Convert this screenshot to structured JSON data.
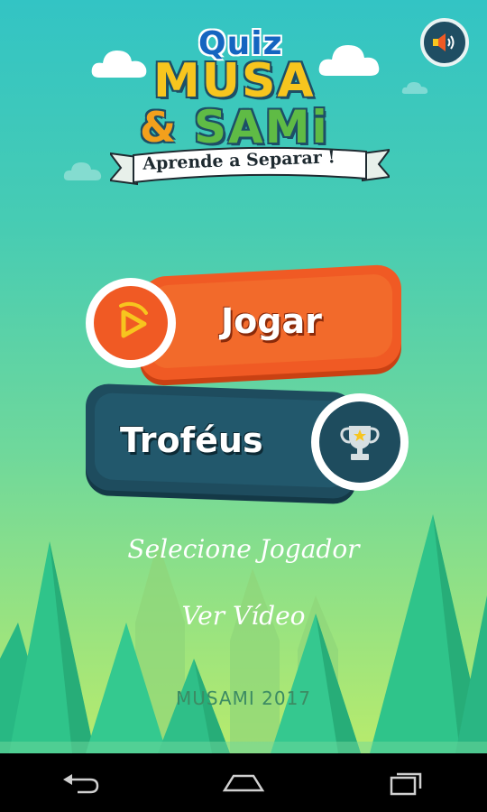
{
  "logo": {
    "quiz": "Quiz",
    "musa": "MUSA",
    "and": "&",
    "sami": "SAMi",
    "tagline": "Aprende a Separar !"
  },
  "sound": {
    "icon": "speaker-volume-icon"
  },
  "menu": {
    "play_label": "Jogar",
    "play_icon": "play-icon",
    "trophies_label": "Troféus",
    "trophies_icon": "trophy-icon",
    "select_player_label": "Selecione Jogador",
    "watch_video_label": "Ver Vídeo"
  },
  "footer": {
    "credit": "MUSAMI 2017"
  },
  "navbar": {
    "back_icon": "back-arrow-icon",
    "home_icon": "home-icon",
    "recents_icon": "recent-apps-icon"
  },
  "colors": {
    "sky_top": "#33c4c4",
    "sky_bottom": "#b8eb6c",
    "play_orange": "#f05a24",
    "trophy_navy": "#1e4c5e",
    "tree_green": "#2fc48a"
  }
}
